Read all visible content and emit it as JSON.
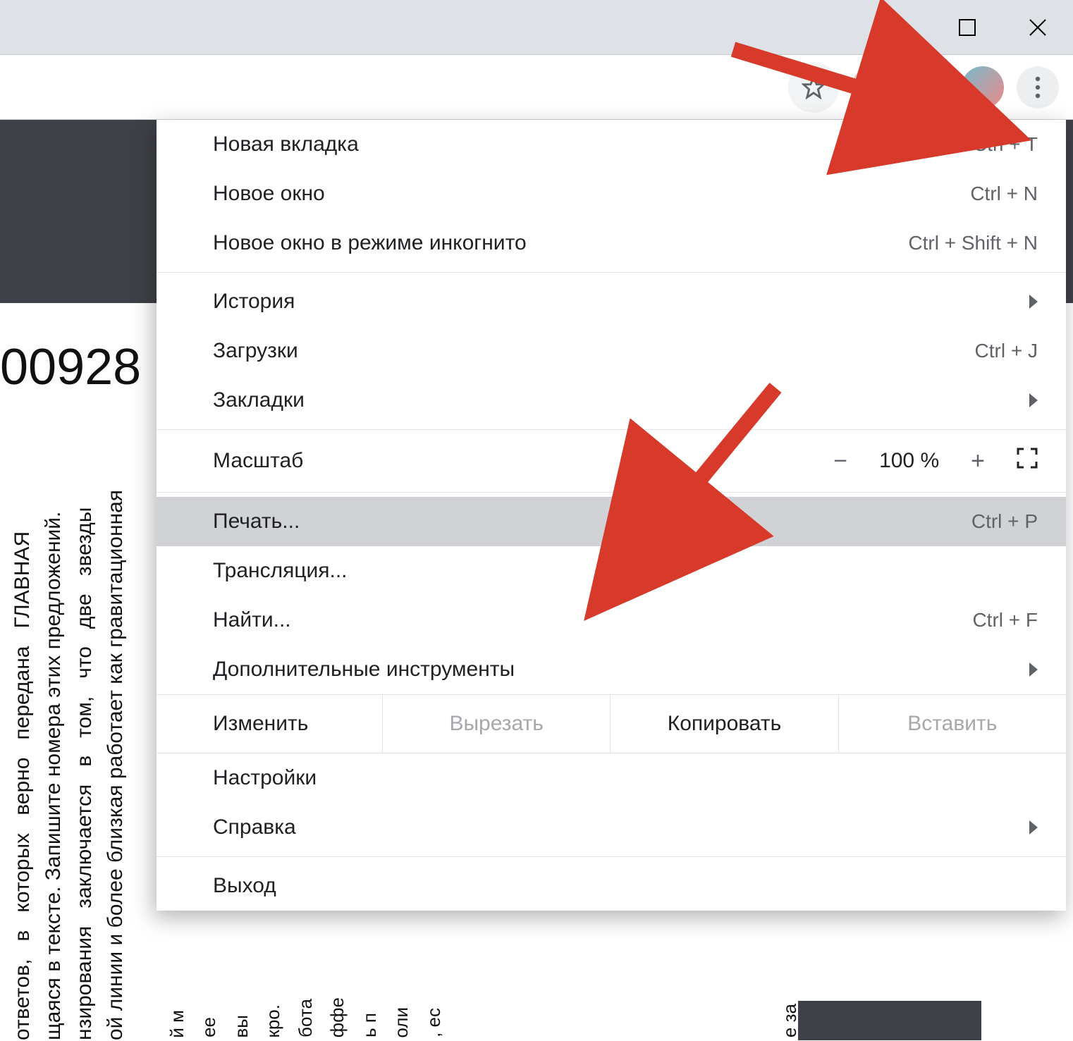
{
  "window": {
    "title": ""
  },
  "page": {
    "heading_number": "00928",
    "leftText": "ответов,   в   которых   верно   передана   ГЛАВНАЯ\nщаяся в тексте. Запишите номера этих предложений.\nнзирования   заключается   в   том,   что   две   звезды\nой линии и более близкая работает как гравитационная"
  },
  "menu": {
    "groups": [
      {
        "type": "item",
        "label": "Новая вкладка",
        "shortcut": "Ctrl + T"
      },
      {
        "type": "item",
        "label": "Новое окно",
        "shortcut": "Ctrl + N"
      },
      {
        "type": "item",
        "label": "Новое окно в режиме инкогнито",
        "shortcut": "Ctrl + Shift + N"
      },
      {
        "type": "sep"
      },
      {
        "type": "submenu",
        "label": "История"
      },
      {
        "type": "item",
        "label": "Загрузки",
        "shortcut": "Ctrl + J"
      },
      {
        "type": "submenu",
        "label": "Закладки"
      },
      {
        "type": "sep"
      },
      {
        "type": "zoom",
        "label": "Масштаб",
        "value": "100 %"
      },
      {
        "type": "sep"
      },
      {
        "type": "item",
        "label": "Печать...",
        "shortcut": "Ctrl + P",
        "highlight": true
      },
      {
        "type": "item",
        "label": "Трансляция..."
      },
      {
        "type": "item",
        "label": "Найти...",
        "shortcut": "Ctrl + F"
      },
      {
        "type": "submenu",
        "label": "Дополнительные инструменты"
      },
      {
        "type": "edit",
        "label": "Изменить",
        "cut": "Вырезать",
        "copy": "Копировать",
        "paste": "Вставить"
      },
      {
        "type": "item",
        "label": "Настройки"
      },
      {
        "type": "submenu",
        "label": "Справка"
      },
      {
        "type": "sep"
      },
      {
        "type": "item",
        "label": "Выход"
      }
    ]
  },
  "icons": {
    "star": "star-icon",
    "extension": "extension-icon",
    "puzzle": "puzzle-icon",
    "profile": "profile-icon",
    "menu": "more-vert-icon"
  }
}
